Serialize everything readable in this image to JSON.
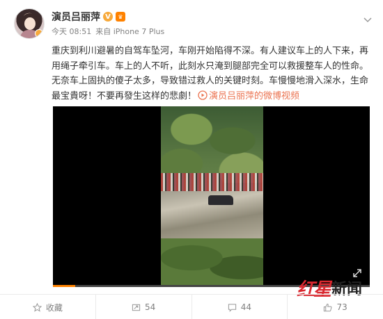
{
  "post": {
    "author": "演员吕丽萍",
    "verified_icon": "v-icon",
    "time": "今天 08:51",
    "source": "来自 iPhone 7 Plus",
    "content": {
      "text_main": "重庆到利川避暑的自驾车坠河，车刚开始陷得不深。有人建议车上的人下来，再用绳子牵引车。车上的人不听，此刻水只淹到腿部完全可以救援整车人的性命。无奈车上固执的傻子太多，导致错过救人的关键时刻。车慢慢地滑入深水，生命最宝貴呀！不要再發生这样的悲劇！",
      "link_text": "演员吕丽萍的微博视频"
    },
    "video": {
      "progress_percent": 7
    }
  },
  "actions": {
    "favorite": "收藏",
    "repost_count": "54",
    "comment_count": "44",
    "like_count": "73"
  },
  "watermark": {
    "part1": "红星",
    "part2": "新闻"
  },
  "colors": {
    "accent": "#eb7350",
    "orange": "#ff8200",
    "gray_text": "#808080",
    "watermark_red": "#d9282f"
  }
}
